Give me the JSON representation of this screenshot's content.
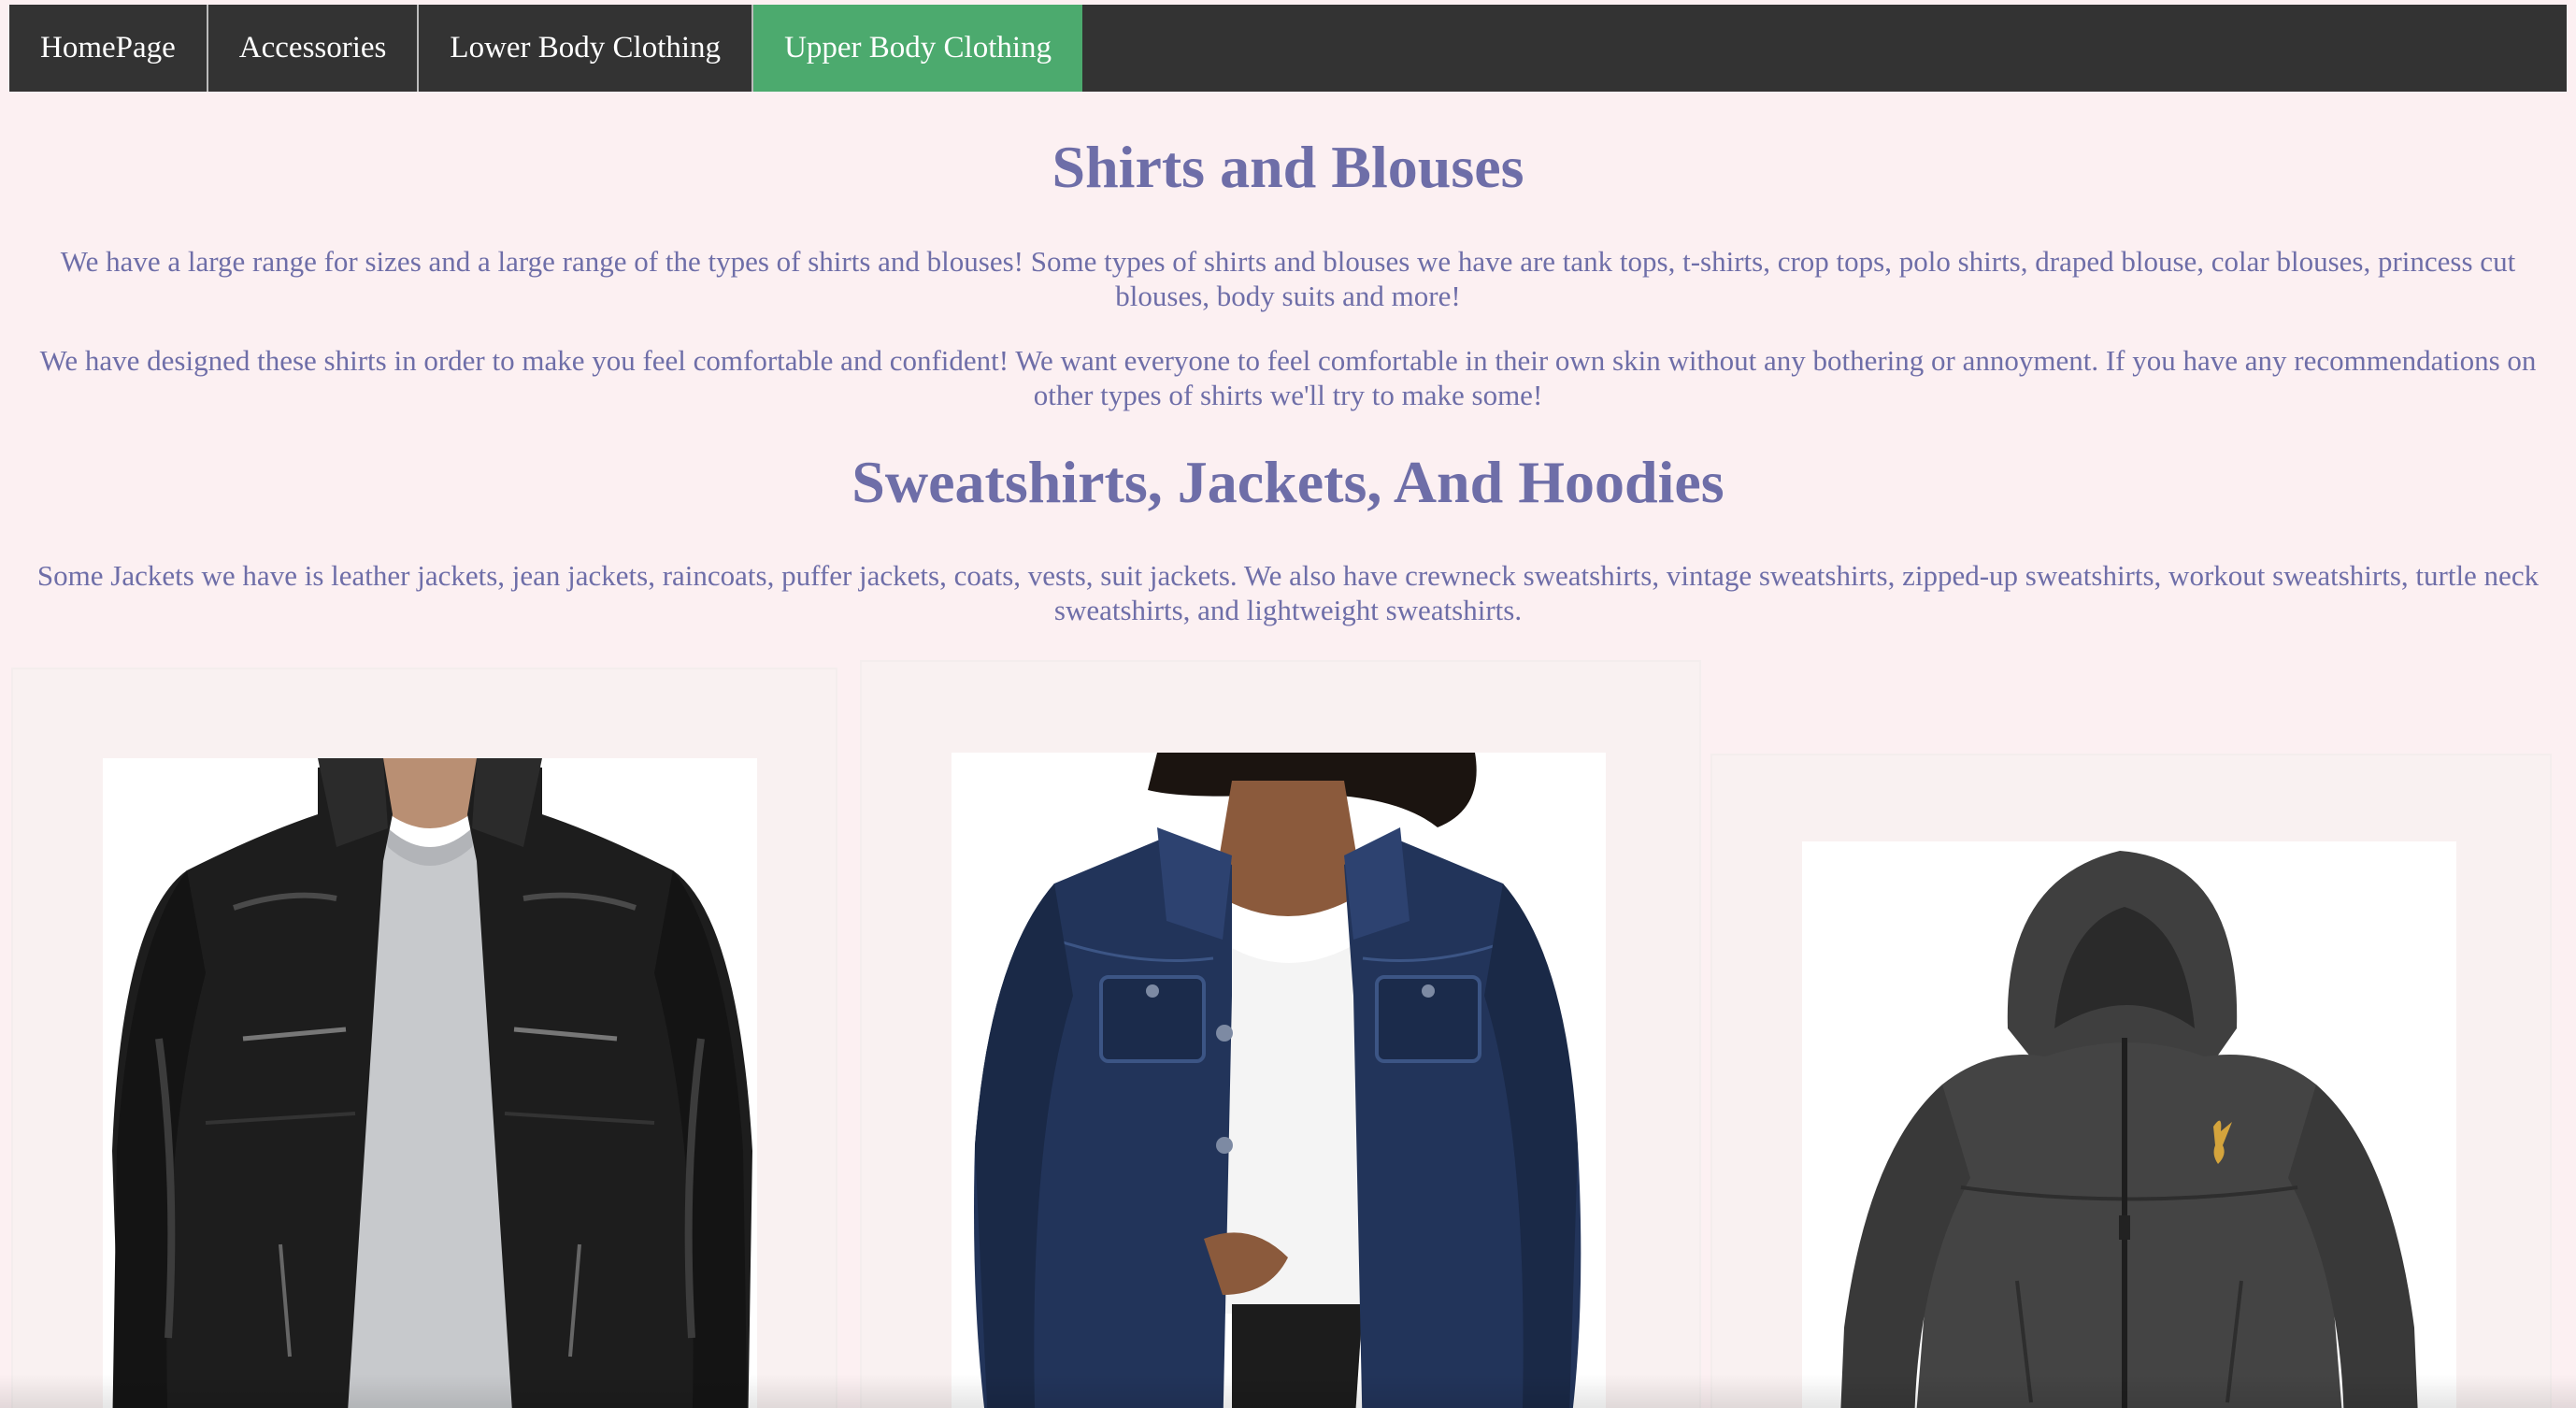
{
  "nav": {
    "items": [
      {
        "label": "HomePage"
      },
      {
        "label": "Accessories"
      },
      {
        "label": "Lower Body Clothing"
      },
      {
        "label": "Upper Body Clothing",
        "active": true
      }
    ],
    "active_color": "#4caa6e",
    "bar_color": "#333333"
  },
  "shirts": {
    "title": "Shirts and Blouses",
    "paragraph_1": "We have a large range for sizes and a large range of the types of shirts and blouses! Some types of shirts and blouses we have are tank tops, t-shirts, crop tops, polo shirts, draped blouse, colar blouses, princess cut blouses, body suits and more!",
    "paragraph_2": "We have designed these shirts in order to make you feel comfortable and confident! We want everyone to feel comfortable in their own skin without any bothering or annoyment. If you have any recommendations on other types of shirts we'll try to make some!"
  },
  "sweatshirts": {
    "title": "Sweatshirts, Jackets, And Hoodies",
    "paragraph": "Some Jackets we have is leather jackets, jean jackets, raincoats, puffer jackets, coats, vests, suit jackets. We also have crewneck sweatshirts, vintage sweatshirts, zipped-up sweatshirts, workout sweatshirts, turtle neck sweatshirts, and lightweight sweatshirts."
  },
  "gallery": {
    "products": [
      {
        "image": "black-leather-jacket"
      },
      {
        "image": "denim-jean-jacket"
      },
      {
        "image": "gray-hooded-rain-jacket"
      }
    ]
  },
  "colors": {
    "background": "#fcf0f2",
    "text": "#6e6ea8"
  }
}
